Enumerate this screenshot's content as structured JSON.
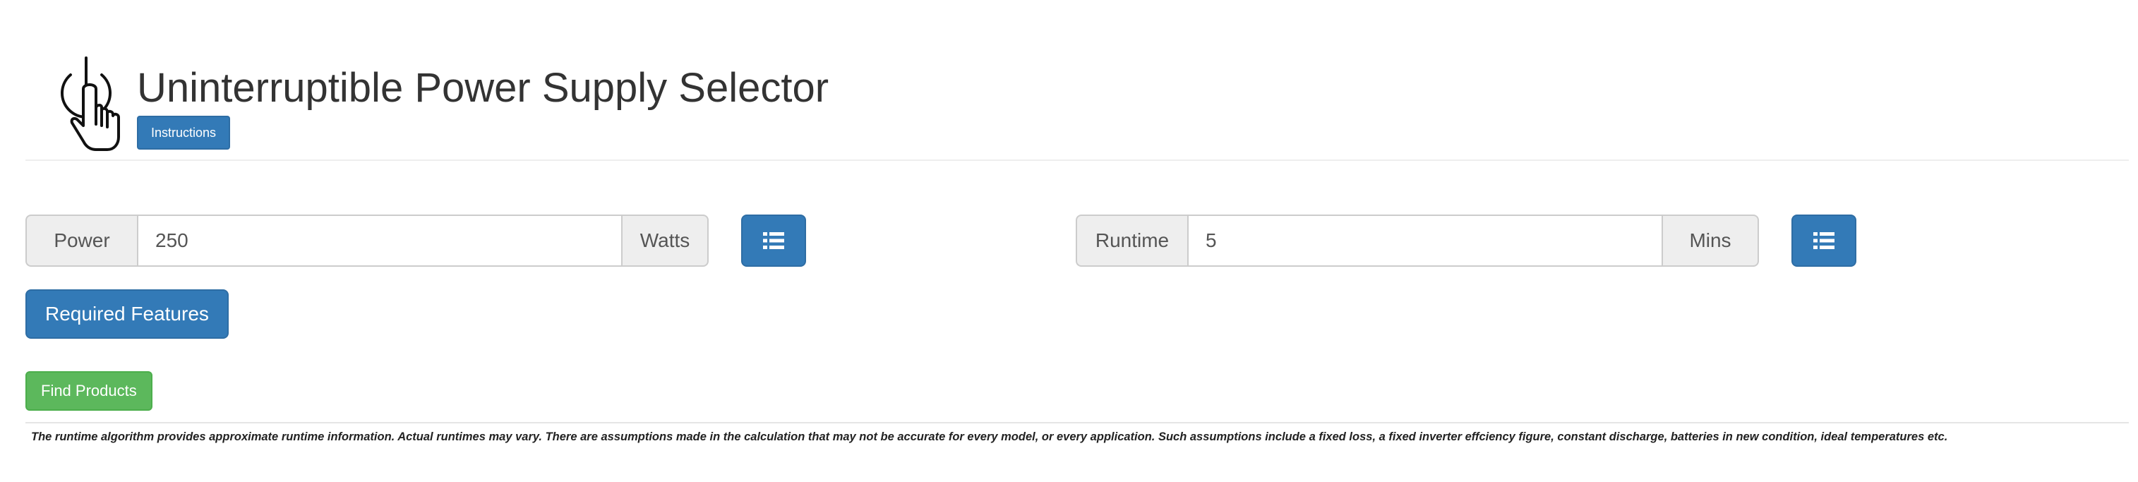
{
  "header": {
    "logo_icon": "power-touch-icon",
    "title": "Uninterruptible Power Supply Selector",
    "instructions_label": "Instructions"
  },
  "power": {
    "label": "Power",
    "value": "250",
    "unit": "Watts",
    "list_icon": "list-icon"
  },
  "runtime": {
    "label": "Runtime",
    "value": "5",
    "unit": "Mins",
    "list_icon": "list-icon"
  },
  "actions": {
    "required_features_label": "Required Features",
    "find_products_label": "Find Products"
  },
  "disclaimer": "The runtime algorithm provides approximate runtime information. Actual runtimes may vary. There are assumptions made in the calculation that may not be accurate for every model, or every application. Such assumptions include a fixed loss, a fixed inverter effciency figure, constant discharge, batteries in new condition, ideal temperatures etc.",
  "colors": {
    "primary": "#337ab7",
    "success": "#5cb85c",
    "addon_bg": "#eeeeee",
    "border": "#cccccc"
  }
}
